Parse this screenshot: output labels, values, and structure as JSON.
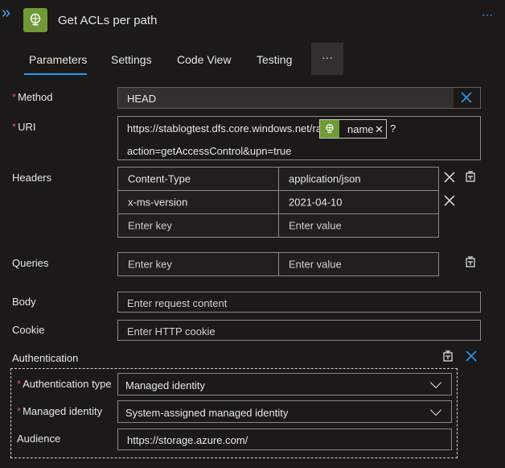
{
  "header": {
    "title": "Get ACLs per path",
    "more_glyph": "⋯",
    "collapse_glyph": "»"
  },
  "tabs": [
    {
      "label": "Parameters",
      "selected": true
    },
    {
      "label": "Settings",
      "selected": false
    },
    {
      "label": "Code View",
      "selected": false
    },
    {
      "label": "Testing",
      "selected": false
    }
  ],
  "tabs_more": "···",
  "fields": {
    "method": {
      "label": "Method",
      "required": "*",
      "value": "HEAD"
    },
    "uri": {
      "label": "URI",
      "required": "*",
      "prefix": "https://stablogtest.dfs.core.windows.net/raw/",
      "token": "name",
      "suffix": "?",
      "line2": "action=getAccessControl&upn=true"
    },
    "headers": {
      "label": "Headers",
      "rows": [
        {
          "key": "Content-Type",
          "value": "application/json"
        },
        {
          "key": "x-ms-version",
          "value": "2021-04-10"
        }
      ],
      "key_placeholder": "Enter key",
      "value_placeholder": "Enter value"
    },
    "queries": {
      "label": "Queries",
      "key_placeholder": "Enter key",
      "value_placeholder": "Enter value"
    },
    "body": {
      "label": "Body",
      "placeholder": "Enter request content"
    },
    "cookie": {
      "label": "Cookie",
      "placeholder": "Enter HTTP cookie"
    },
    "authentication": {
      "label": "Authentication",
      "type_label": "Authentication type",
      "type_required": "*",
      "type_value": "Managed identity",
      "identity_label": "Managed identity",
      "identity_required": "*",
      "identity_value": "System-assigned managed identity",
      "audience_label": "Audience",
      "audience_value": "https://storage.azure.com/"
    }
  },
  "colors": {
    "accent": "#2899f5",
    "action_icon_bg": "#6f9a37",
    "required": "#e0544e"
  }
}
